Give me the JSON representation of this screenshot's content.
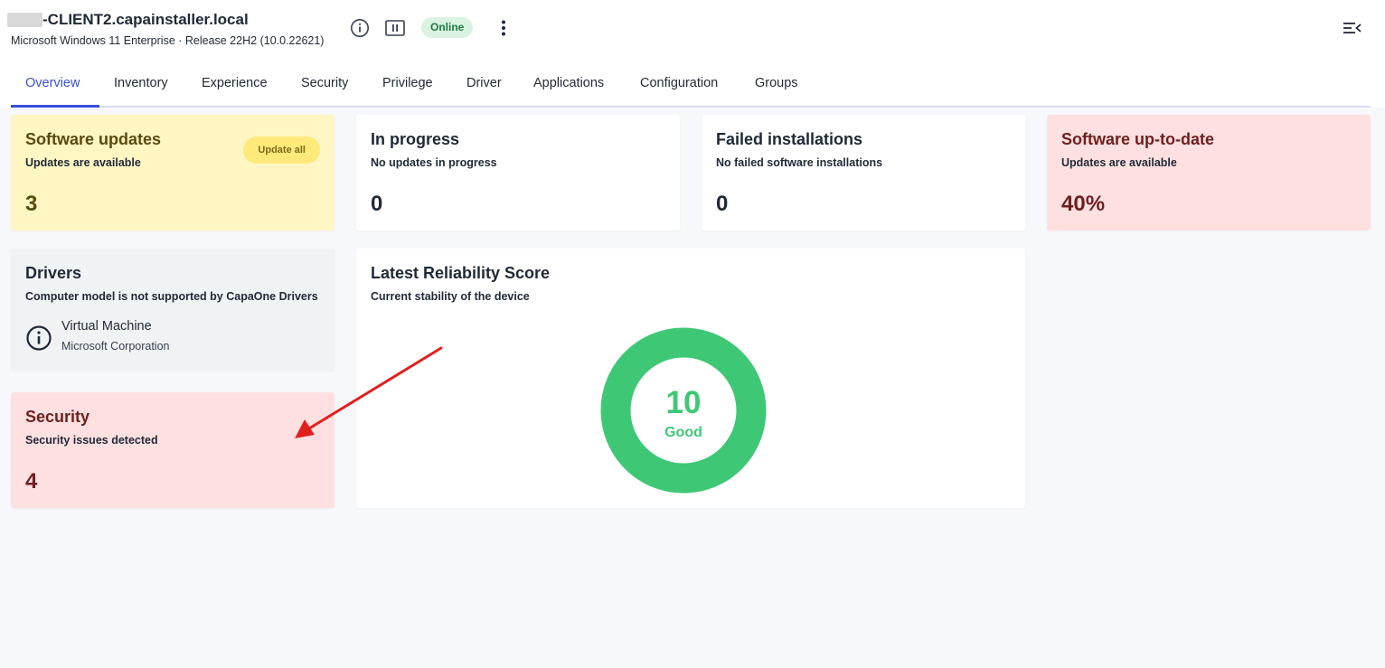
{
  "device": {
    "name_suffix": "-CLIENT2.capainstaller.local",
    "os": "Microsoft Windows 11 Enterprise · Release 22H2 (10.0.22621)",
    "status": "Online"
  },
  "colors": {
    "accent": "#3b4fd8",
    "online_bg": "#d9f2e1",
    "online_text": "#1f7a45",
    "gauge_good": "#3ec875",
    "warning_bg": "#fff6c4",
    "danger_bg": "#ffe0e0",
    "annotation": "#e0201d"
  },
  "icons": {
    "info": "info-circle-icon",
    "pause": "pause-icon",
    "menu": "kebab-menu-icon",
    "collapse": "collapse-panel-icon",
    "driver": "info-circle-icon"
  },
  "tabs": [
    {
      "label": "Overview",
      "active": true
    },
    {
      "label": "Inventory"
    },
    {
      "label": "Experience"
    },
    {
      "label": "Security"
    },
    {
      "label": "Privilege"
    },
    {
      "label": "Driver"
    },
    {
      "label": "Applications"
    },
    {
      "label": "Configuration"
    },
    {
      "label": "Groups"
    }
  ],
  "cards": {
    "software_updates": {
      "title": "Software updates",
      "subtitle": "Updates are available",
      "value": "3",
      "button": "Update all"
    },
    "in_progress": {
      "title": "In progress",
      "subtitle": "No updates in progress",
      "value": "0"
    },
    "failed": {
      "title": "Failed installations",
      "subtitle": "No failed software installations",
      "value": "0"
    },
    "up_to_date": {
      "title": "Software up-to-date",
      "subtitle": "Updates are available",
      "value": "40%"
    },
    "drivers": {
      "title": "Drivers",
      "subtitle": "Computer model is not supported by CapaOne Drivers",
      "model": "Virtual Machine",
      "vendor": "Microsoft Corporation"
    },
    "security": {
      "title": "Security",
      "subtitle": "Security issues detected",
      "value": "4"
    },
    "reliability": {
      "title": "Latest Reliability Score",
      "subtitle": "Current stability of the device",
      "score": "10",
      "rating": "Good",
      "score_fraction": 1.0
    }
  }
}
